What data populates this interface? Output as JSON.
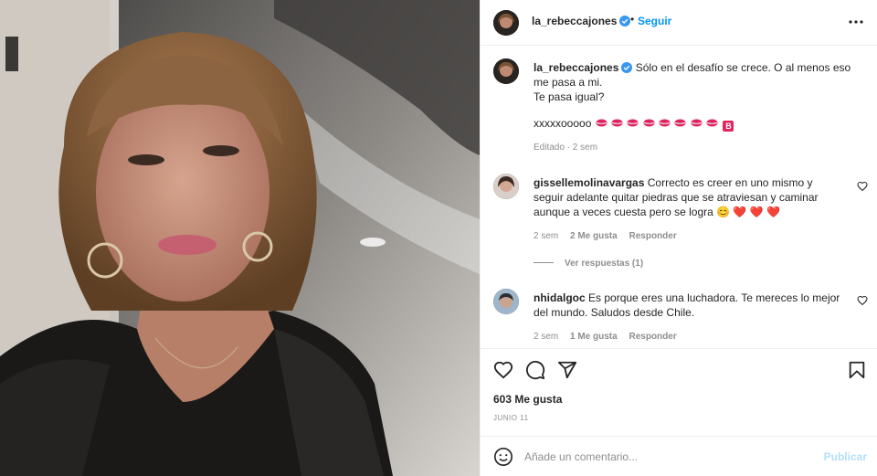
{
  "photo": {
    "alt_icon": "selfie-photo"
  },
  "header": {
    "username": "la_rebeccajones",
    "separator": "•",
    "follow_label": "Seguir",
    "more_icon": "more-horizontal-icon"
  },
  "caption": {
    "username": "la_rebeccajones",
    "lines": [
      "Sólo en el desafío se crece. O al menos eso me pasa a mi.",
      "Te pasa igual?"
    ],
    "xo": "xxxxxooooo",
    "badge": "B",
    "edited": "Editado · 2 sem"
  },
  "comments": [
    {
      "username": "gissellemolinavargas",
      "text": "Correcto es creer en uno mismo y seguir adelante quitar piedras que se atraviesan y caminar aunque a veces cuesta pero se logra",
      "emojis": "😊 ❤️ ❤️ ❤️",
      "time": "2 sem",
      "likes": "2 Me gusta",
      "reply": "Responder"
    },
    {
      "username": "nhidalgoc",
      "text": "Es porque eres una luchadora. Te mereces lo mejor del mundo. Saludos desde Chile.",
      "time": "2 sem",
      "likes": "1 Me gusta",
      "reply": "Responder"
    }
  ],
  "view_replies": "Ver respuestas (1)",
  "actions": {
    "icons": [
      "heart-icon",
      "comment-icon",
      "share-icon",
      "bookmark-icon"
    ],
    "likes": "603 Me gusta",
    "date": "JUNIO 11"
  },
  "comment_box": {
    "placeholder": "Añade un comentario...",
    "publish_label": "Publicar"
  },
  "colors": {
    "accent": "#0095f6",
    "muted": "#8e8e8e",
    "text": "#262626",
    "publish_disabled": "#b2dffc",
    "heart_red": "#ed4956"
  }
}
